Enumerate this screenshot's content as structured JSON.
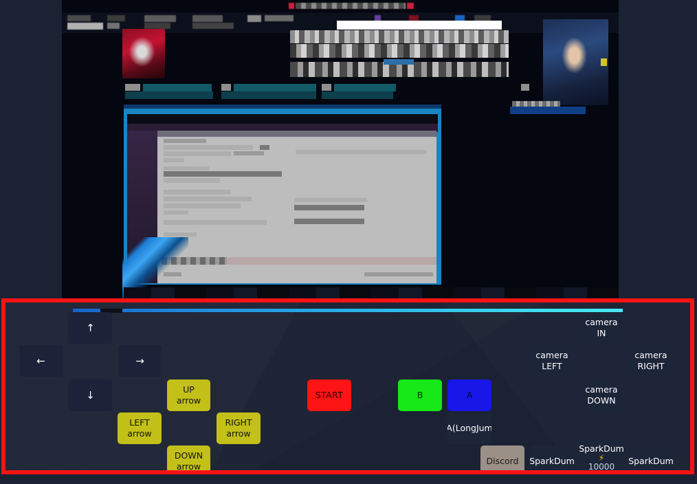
{
  "colors": {
    "panel_border": "#f71414",
    "panel_bg": "#1b2233",
    "button_dark": "#1d2539",
    "button_yellow": "#c3c019",
    "start_red": "#fd1414",
    "b_green": "#17e817",
    "a_blue": "#1717e8",
    "discord_grey": "#9a9088",
    "progress_start": "#1763c9",
    "progress_end": "#47e8f4"
  },
  "stream": {
    "description": "pixelated stream overlay with game window"
  },
  "control_panel": {
    "progress_value": "",
    "nav_keys": [
      {
        "name": "arrow-up",
        "label": "↑"
      },
      {
        "name": "arrow-left",
        "label": "←"
      },
      {
        "name": "arrow-right",
        "label": "→"
      },
      {
        "name": "arrow-down",
        "label": "↓"
      }
    ],
    "dpad": [
      {
        "name": "up-arrow",
        "line1": "UP",
        "line2": "arrow"
      },
      {
        "name": "left-arrow",
        "line1": "LEFT",
        "line2": "arrow"
      },
      {
        "name": "right-arrow",
        "line1": "RIGHT",
        "line2": "arrow"
      },
      {
        "name": "down-arrow",
        "line1": "DOWN",
        "line2": "arrow"
      }
    ],
    "action_buttons": [
      {
        "name": "start",
        "label": "START"
      },
      {
        "name": "b",
        "label": "B"
      },
      {
        "name": "a",
        "label": "A"
      }
    ],
    "a_longjump": {
      "label": "A(LongJum"
    },
    "camera_buttons": [
      {
        "name": "camera-in",
        "line1": "camera",
        "line2": "IN"
      },
      {
        "name": "camera-left",
        "line1": "camera",
        "line2": "LEFT"
      },
      {
        "name": "camera-right",
        "line1": "camera",
        "line2": "RIGHT"
      },
      {
        "name": "camera-down",
        "line1": "camera",
        "line2": "DOWN"
      }
    ],
    "bottom_buttons": [
      {
        "name": "discord",
        "label": "Discord"
      },
      {
        "name": "sparkdump-1",
        "label": "SparkDum"
      },
      {
        "name": "sparkdump-2",
        "label": "SparkDum",
        "bolt": "⚡",
        "amount": "10000"
      },
      {
        "name": "sparkdump-3",
        "label": "SparkDum"
      }
    ]
  }
}
